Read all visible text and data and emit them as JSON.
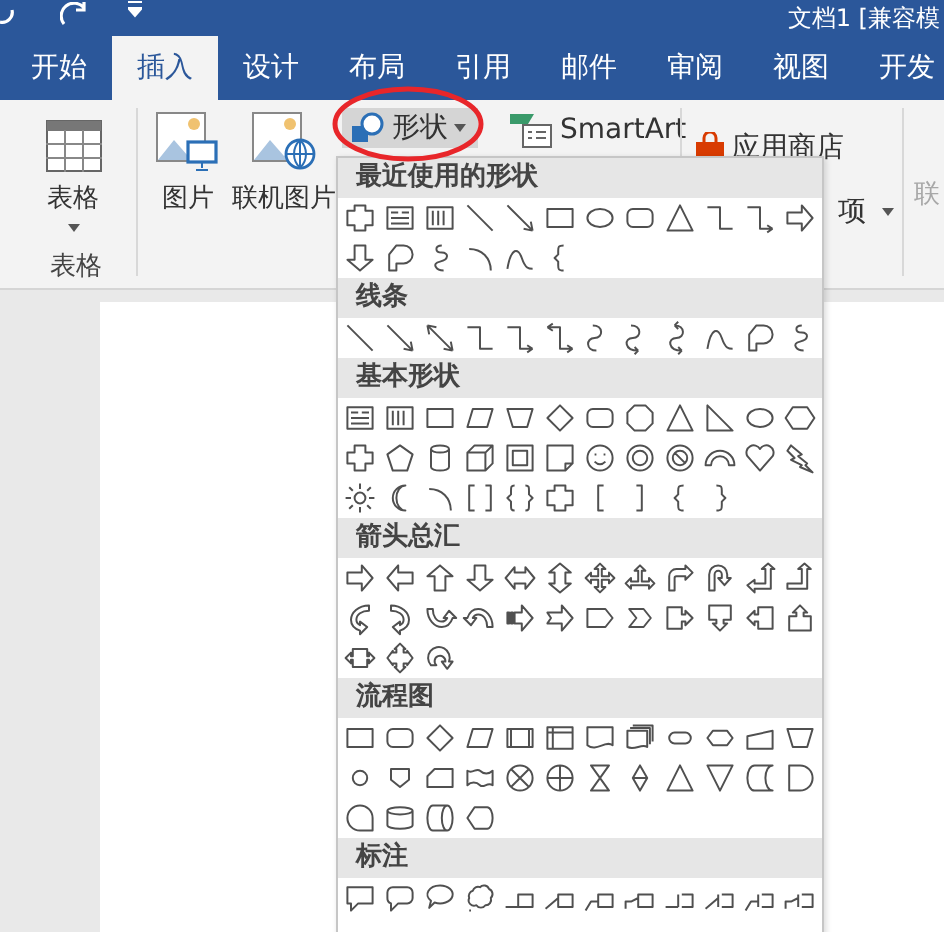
{
  "window": {
    "title": "文档1 [兼容模"
  },
  "tabs": [
    {
      "label": "开始",
      "selected": false
    },
    {
      "label": "插入",
      "selected": true
    },
    {
      "label": "设计",
      "selected": false
    },
    {
      "label": "布局",
      "selected": false
    },
    {
      "label": "引用",
      "selected": false
    },
    {
      "label": "邮件",
      "selected": false
    },
    {
      "label": "审阅",
      "selected": false
    },
    {
      "label": "视图",
      "selected": false
    },
    {
      "label": "开发",
      "selected": false
    }
  ],
  "ribbon": {
    "table_button": "表格",
    "table_group_label": "表格",
    "picture_button": "图片",
    "online_picture_button": "联机图片",
    "shapes_button": "形状",
    "smartart_button": "SmartArt",
    "store_button": "应用商店",
    "addins_button": "项",
    "online_button": {
      "label": "联",
      "disabled": true
    }
  },
  "annotation_circle": true,
  "shapes_menu": {
    "sections": [
      {
        "title": "最近使用的形状",
        "shapes": [
          {
            "kind": "plaque"
          },
          {
            "kind": "textbox"
          },
          {
            "kind": "vtextbox"
          },
          {
            "kind": "line"
          },
          {
            "kind": "arrowline"
          },
          {
            "kind": "rect"
          },
          {
            "kind": "ellipse"
          },
          {
            "kind": "rounded"
          },
          {
            "kind": "triangle"
          },
          {
            "kind": "elbow"
          },
          {
            "kind": "elbowarrow"
          },
          {
            "kind": "arrowR"
          },
          {
            "kind": "arrowD"
          },
          {
            "kind": "freeform"
          },
          {
            "kind": "scribble"
          },
          {
            "kind": "arc"
          },
          {
            "kind": "curve"
          },
          {
            "kind": "braceL"
          }
        ]
      },
      {
        "title": "线条",
        "shapes": [
          {
            "kind": "line"
          },
          {
            "kind": "arrowline"
          },
          {
            "kind": "dblarrowline"
          },
          {
            "kind": "elbow"
          },
          {
            "kind": "elbowarrow"
          },
          {
            "kind": "elbowdbl"
          },
          {
            "kind": "curvecon"
          },
          {
            "kind": "curvearrow"
          },
          {
            "kind": "curvedbl"
          },
          {
            "kind": "curve"
          },
          {
            "kind": "freeform"
          },
          {
            "kind": "scribble"
          }
        ]
      },
      {
        "title": "基本形状",
        "shapes": [
          {
            "kind": "textbox"
          },
          {
            "kind": "vtextbox"
          },
          {
            "kind": "rect"
          },
          {
            "kind": "parallelogram"
          },
          {
            "kind": "trapezoid"
          },
          {
            "kind": "diamond"
          },
          {
            "kind": "rounded"
          },
          {
            "kind": "octagon"
          },
          {
            "kind": "triangle"
          },
          {
            "kind": "righttri"
          },
          {
            "kind": "ellipse"
          },
          {
            "kind": "hexagon"
          },
          {
            "kind": "cross"
          },
          {
            "kind": "pentagon"
          },
          {
            "kind": "cylinder"
          },
          {
            "kind": "cube"
          },
          {
            "kind": "frame"
          },
          {
            "kind": "folded"
          },
          {
            "kind": "smiley"
          },
          {
            "kind": "donut"
          },
          {
            "kind": "nosymbol"
          },
          {
            "kind": "blockarc"
          },
          {
            "kind": "heart"
          },
          {
            "kind": "lightning"
          },
          {
            "kind": "sun"
          },
          {
            "kind": "moon"
          },
          {
            "kind": "arc"
          },
          {
            "kind": "dblbracket"
          },
          {
            "kind": "dblbrace"
          },
          {
            "kind": "plaque"
          },
          {
            "kind": "bracketL"
          },
          {
            "kind": "bracketR"
          },
          {
            "kind": "braceL"
          },
          {
            "kind": "braceR"
          }
        ]
      },
      {
        "title": "箭头总汇",
        "shapes": [
          {
            "kind": "arrowR"
          },
          {
            "kind": "arrowL"
          },
          {
            "kind": "arrowU"
          },
          {
            "kind": "arrowD"
          },
          {
            "kind": "arrowLR"
          },
          {
            "kind": "arrowUD"
          },
          {
            "kind": "arrowQuad"
          },
          {
            "kind": "arrowLRU"
          },
          {
            "kind": "bentArrow"
          },
          {
            "kind": "uturn"
          },
          {
            "kind": "leftup"
          },
          {
            "kind": "bentup"
          },
          {
            "kind": "curvedR"
          },
          {
            "kind": "curvedL"
          },
          {
            "kind": "curvedU"
          },
          {
            "kind": "curvedD"
          },
          {
            "kind": "striped"
          },
          {
            "kind": "notched"
          },
          {
            "kind": "pentArrow"
          },
          {
            "kind": "chevron"
          },
          {
            "kind": "calloutR"
          },
          {
            "kind": "calloutD"
          },
          {
            "kind": "calloutL"
          },
          {
            "kind": "calloutU"
          },
          {
            "kind": "calloutLR"
          },
          {
            "kind": "calloutQuad"
          },
          {
            "kind": "circArrow"
          }
        ]
      },
      {
        "title": "流程图",
        "shapes": [
          {
            "kind": "rect"
          },
          {
            "kind": "rounded"
          },
          {
            "kind": "diamond"
          },
          {
            "kind": "parallelogram"
          },
          {
            "kind": "predefined"
          },
          {
            "kind": "internal"
          },
          {
            "kind": "document"
          },
          {
            "kind": "multidoc"
          },
          {
            "kind": "terminator"
          },
          {
            "kind": "preparation"
          },
          {
            "kind": "manualinput"
          },
          {
            "kind": "trapezoid"
          },
          {
            "kind": "connector"
          },
          {
            "kind": "offpage"
          },
          {
            "kind": "card"
          },
          {
            "kind": "tape"
          },
          {
            "kind": "summing"
          },
          {
            "kind": "or"
          },
          {
            "kind": "collate"
          },
          {
            "kind": "sort"
          },
          {
            "kind": "triangle"
          },
          {
            "kind": "merge"
          },
          {
            "kind": "stored"
          },
          {
            "kind": "delay"
          },
          {
            "kind": "seq"
          },
          {
            "kind": "disk"
          },
          {
            "kind": "direct"
          },
          {
            "kind": "display"
          }
        ]
      },
      {
        "title": "标注",
        "shapes": [
          {
            "kind": "rectcallout"
          },
          {
            "kind": "roundcallout"
          },
          {
            "kind": "ovalcallout"
          },
          {
            "kind": "cloudcallout"
          },
          {
            "kind": "linecallout"
          },
          {
            "kind": "linecallout2"
          },
          {
            "kind": "linecallout3"
          },
          {
            "kind": "linecallout4"
          },
          {
            "kind": "linecalloutd"
          },
          {
            "kind": "linecallout2d"
          },
          {
            "kind": "linecallout3d"
          },
          {
            "kind": "linecallout4d"
          }
        ]
      }
    ]
  }
}
